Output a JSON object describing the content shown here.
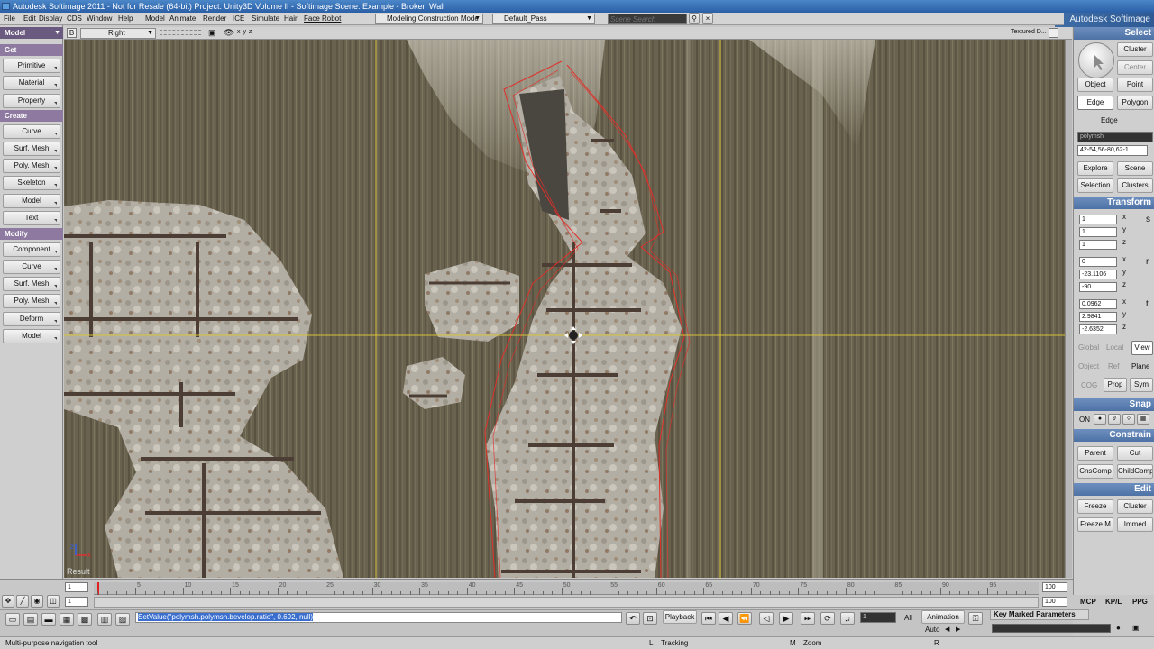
{
  "window": {
    "title": "Autodesk Softimage 2011 - Not for Resale (64-bit)   Project: Unity3D Volume II - Softimage   Scene: Example - Broken Wall",
    "brand": "Autodesk Softimage"
  },
  "menu": {
    "file": "File",
    "edit": "Edit",
    "display": "Display",
    "cds": "CDS",
    "window": "Window",
    "help": "Help",
    "model": "Model",
    "animate": "Animate",
    "render": "Render",
    "ice": "ICE",
    "simulate": "Simulate",
    "hair": "Hair",
    "face_robot": "Face Robot",
    "construction_mode": "Modeling Construction Mode",
    "pass": "Default_Pass",
    "scene_search_placeholder": "Scene Search"
  },
  "left_panel": {
    "module": "Model",
    "get": "Get",
    "get_items": [
      "Primitive",
      "Material",
      "Property"
    ],
    "create": "Create",
    "create_items": [
      "Curve",
      "Surf. Mesh",
      "Poly. Mesh",
      "Skeleton",
      "Model",
      "Text"
    ],
    "modify": "Modify",
    "modify_items": [
      "Component",
      "Curve",
      "Surf. Mesh",
      "Poly. Mesh",
      "Deform",
      "Model"
    ]
  },
  "viewport": {
    "letter": "B",
    "view": "Right",
    "axes": "x y z",
    "display_mode": "Textured D...",
    "result_label": "Result",
    "axis_x": "x",
    "axis_z": "z"
  },
  "right_panel": {
    "select": "Select",
    "cluster": "Cluster",
    "center": "Center",
    "object": "Object",
    "point": "Point",
    "edge": "Edge",
    "polygon": "Polygon",
    "edge_combo": "Edge",
    "object_name": "polymsh",
    "component_list": "42-54,56-80,62-1",
    "explore": "Explore",
    "scene": "Scene",
    "selection": "Selection",
    "clusters": "Clusters",
    "transform": "Transform",
    "scale": {
      "label": "s",
      "x": "1",
      "y": "1",
      "z": "1"
    },
    "rotation": {
      "label": "r",
      "x": "0",
      "y": "-23.1106",
      "z": "-90"
    },
    "translation": {
      "label": "t",
      "x": "0.0962",
      "y": "2.9841",
      "z": "-2.6352"
    },
    "axis_labels": {
      "x": "x",
      "y": "y",
      "z": "z"
    },
    "global": "Global",
    "local": "Local",
    "view": "View",
    "object_ref": "Object",
    "ref": "Ref",
    "plane": "Plane",
    "cog": "COG",
    "prop": "Prop",
    "sym": "Sym",
    "snap": "Snap",
    "on": "ON",
    "constrain": "Constrain",
    "parent": "Parent",
    "cut": "Cut",
    "cnscomp": "CnsComp",
    "childcomp": "ChildComp",
    "edit": "Edit",
    "freeze": "Freeze",
    "edit_cluster": "Cluster",
    "freeze_m": "Freeze M",
    "immed": "Immed"
  },
  "timeline": {
    "start": "1",
    "end": "100",
    "current": "1",
    "range_end": "100",
    "ticks": [
      "5",
      "10",
      "15",
      "20",
      "25",
      "30",
      "35",
      "40",
      "45",
      "50",
      "55",
      "60",
      "65",
      "70",
      "75",
      "80",
      "85",
      "90",
      "95"
    ]
  },
  "command_line": {
    "text": "SetValue(\"polymsh.polymsh.bevelop.ratio\", 0.692, null)",
    "playback": "Playback",
    "frame_field": "1",
    "all": "All",
    "animation": "Animation",
    "auto": "Auto",
    "key_marked": "Key Marked Parameters"
  },
  "bottom_tabs": {
    "mcp": "MCP",
    "kpl": "KP/L",
    "ppg": "PPG"
  },
  "status": {
    "tool": "Multi-purpose navigation tool",
    "l": "L",
    "tracking": "Tracking",
    "m": "M",
    "zoom": "Zoom",
    "r": "R"
  },
  "colors": {
    "title_bar": "#2b5fa6",
    "module_header": "#8e7aa0",
    "panel_header": "#4f72a6",
    "crosshair": "#d7c23a",
    "selection_outline": "#e0302a"
  }
}
